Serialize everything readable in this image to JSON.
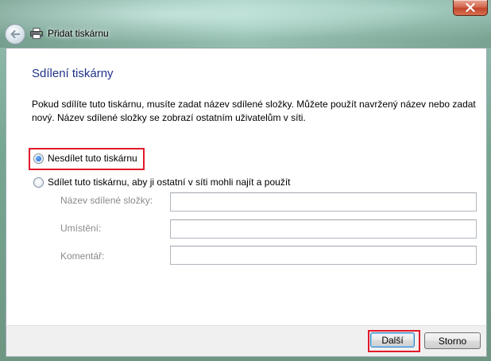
{
  "window": {
    "title": "Přidat tiskárnu",
    "close_label": "✕"
  },
  "page": {
    "heading": "Sdílení tiskárny",
    "description": "Pokud sdílíte tuto tiskárnu, musíte zadat název sdílené složky. Můžete použít navržený název nebo zadat nový. Název sdílené složky se zobrazí ostatním uživatelům v síti."
  },
  "options": {
    "do_not_share": {
      "label": "Nesdílet tuto tiskárnu",
      "selected": true
    },
    "share": {
      "label": "Sdílet tuto tiskárnu, aby ji ostatní v síti mohli najít a použít",
      "selected": false
    }
  },
  "fields": {
    "share_name": {
      "label": "Název sdílené složky:",
      "value": ""
    },
    "location": {
      "label": "Umístění:",
      "value": ""
    },
    "comment": {
      "label": "Komentář:",
      "value": ""
    }
  },
  "buttons": {
    "next": "Další",
    "cancel": "Storno"
  },
  "colors": {
    "highlight": "#e21a2b",
    "heading": "#1e3287"
  }
}
